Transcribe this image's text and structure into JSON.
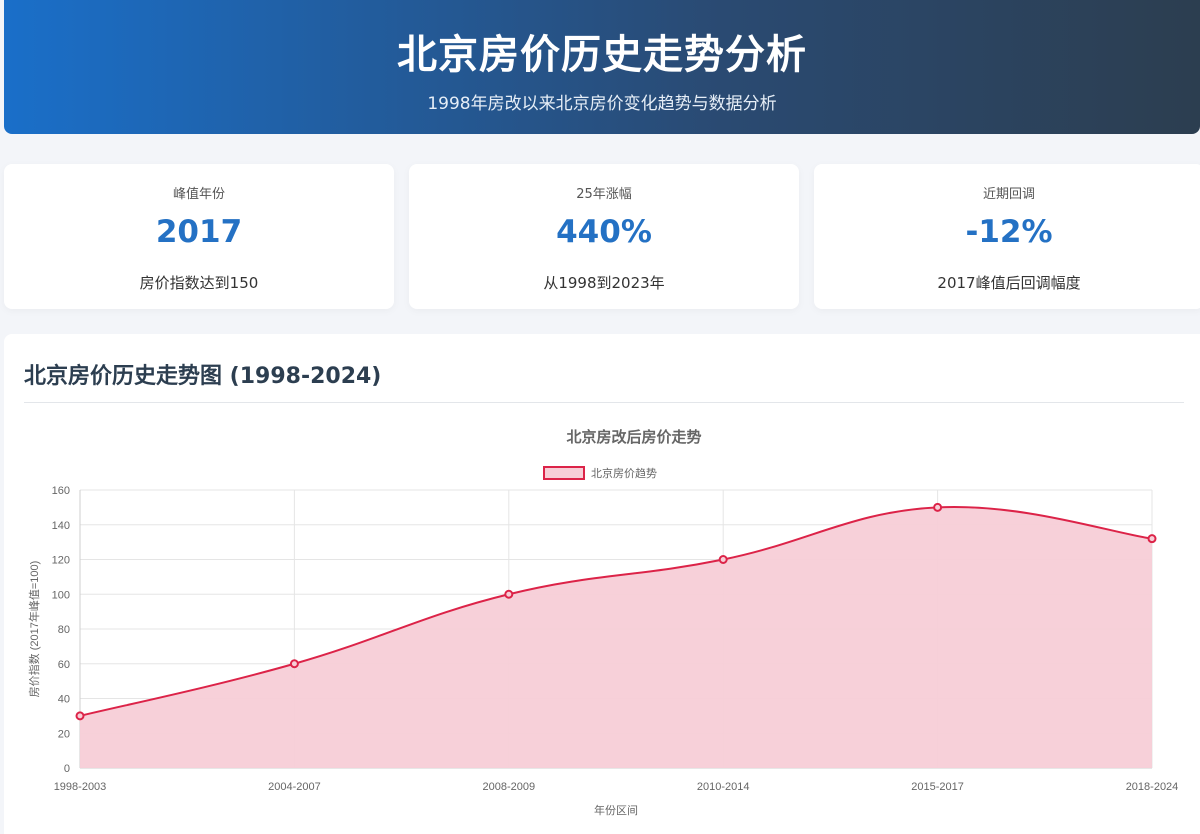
{
  "header": {
    "title": "北京房价历史走势分析",
    "subtitle": "1998年房改以来北京房价变化趋势与数据分析"
  },
  "stats": [
    {
      "label": "峰值年份",
      "value": "2017",
      "desc": "房价指数达到150"
    },
    {
      "label": "25年涨幅",
      "value": "440%",
      "desc": "从1998到2023年"
    },
    {
      "label": "近期回调",
      "value": "-12%",
      "desc": "2017峰值后回调幅度"
    }
  ],
  "chart_panel": {
    "title": "北京房价历史走势图 (1998-2024)"
  },
  "chart_data": {
    "type": "area",
    "title": "北京房改后房价走势",
    "xlabel": "年份区间",
    "ylabel": "房价指数 (2017年峰值=100)",
    "categories": [
      "1998-2003",
      "2004-2007",
      "2008-2009",
      "2010-2014",
      "2015-2017",
      "2018-2024"
    ],
    "series": [
      {
        "name": "北京房价趋势",
        "values": [
          30,
          60,
          100,
          120,
          150,
          132
        ]
      }
    ],
    "ylim": [
      0,
      160
    ],
    "yticks": [
      0,
      20,
      40,
      60,
      80,
      100,
      120,
      140,
      160
    ],
    "grid": true,
    "legend": "top-center",
    "colors": {
      "line": "#dc2348",
      "fill": "#f7ced7"
    }
  }
}
